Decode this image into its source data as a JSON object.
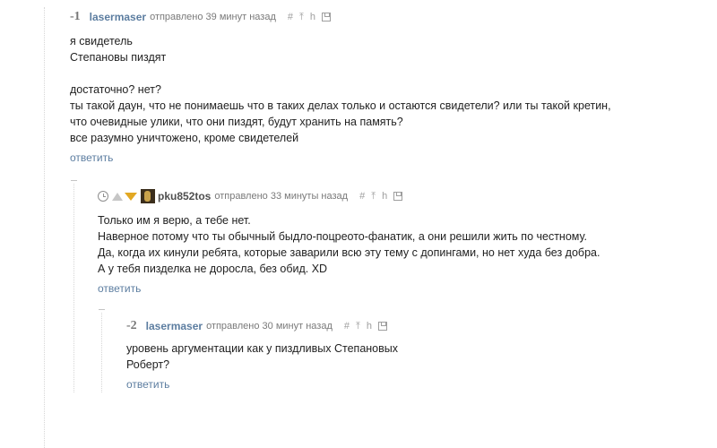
{
  "comments": [
    {
      "score": "-1",
      "user": "lasermaser",
      "meta": "отправлено 39 минут назад",
      "lines": [
        "я свидетель",
        "Степановы пиздят",
        "",
        "достаточно? нет?",
        "ты такой даун, что не понимаешь что в таких делах только и остаются свидетели? или ты такой кретин,",
        "что очевидные улики, что они пиздят, будут хранить на память?",
        "все разумно уничтожено, кроме свидетелей"
      ],
      "reply": "ответить"
    },
    {
      "user": "pku852tos",
      "meta": "отправлено 33 минуты назад",
      "lines": [
        "Только им я верю, а тебе нет.",
        "Наверное потому что ты обычный быдло-поцреото-фанатик, а они решили жить по честному.",
        "Да, когда их кинули ребята, которые заварили всю эту тему с допингами, но нет худа без добра.",
        "А у тебя пизделка не доросла, без обид. XD"
      ],
      "reply": "ответить"
    },
    {
      "score": "-2",
      "user": "lasermaser",
      "meta": "отправлено 30 минут назад",
      "lines": [
        "уровень аргументации как у пиздливых Степановых",
        "Роберт?"
      ],
      "reply": "ответить"
    }
  ],
  "icons": {
    "hash": "#",
    "parent": "⤒",
    "link": "h"
  },
  "colors": {
    "link": "#5c7da0",
    "downvote_active": "#e2a823",
    "text": "#222222",
    "meta": "#7a7a7a"
  }
}
